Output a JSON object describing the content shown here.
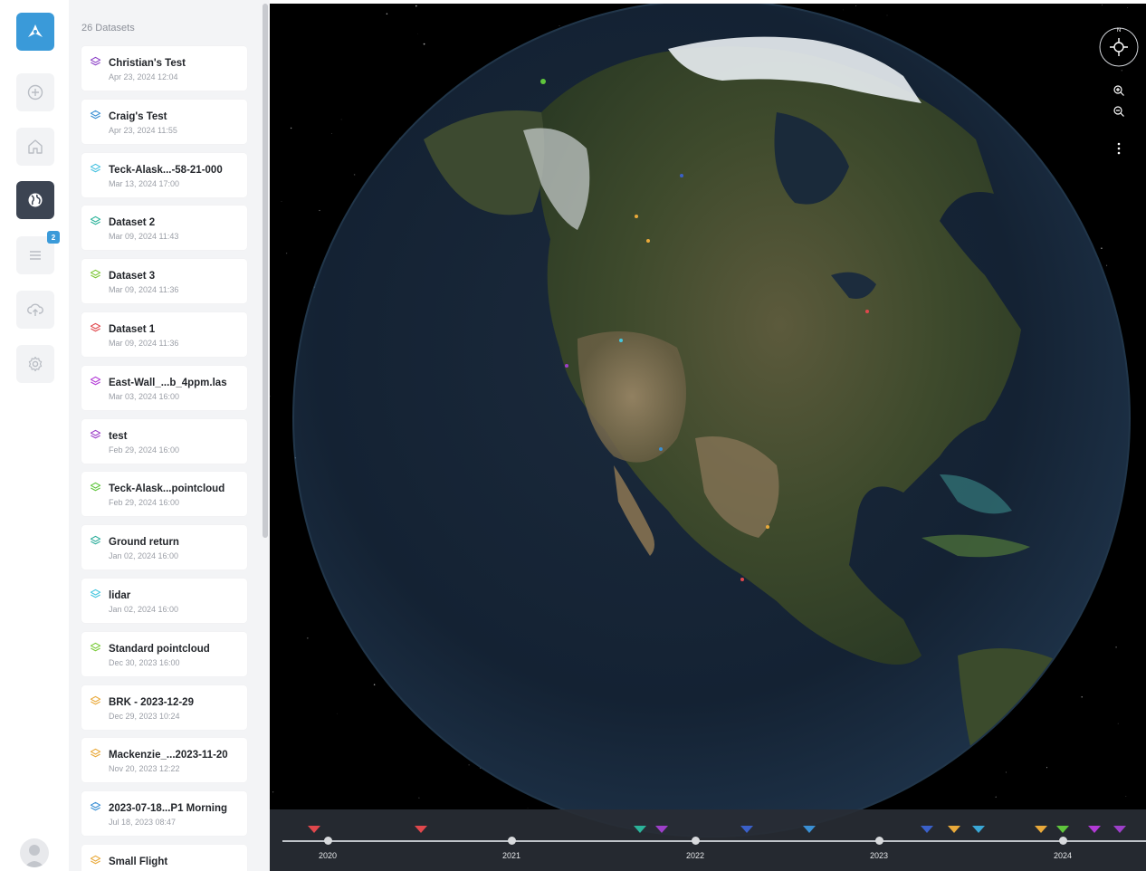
{
  "panel": {
    "title": "26 Datasets",
    "datasets": [
      {
        "name": "Christian's Test",
        "date": "Apr 23, 2024 12:04",
        "color": "#8e44c8"
      },
      {
        "name": "Craig's Test",
        "date": "Apr 23, 2024 11:55",
        "color": "#3a8fd4"
      },
      {
        "name": "Teck-Alask...-58-21-000",
        "date": "Mar 13, 2024 17:00",
        "color": "#49c2e0"
      },
      {
        "name": "Dataset 2",
        "date": "Mar 09, 2024 11:43",
        "color": "#2bb39a"
      },
      {
        "name": "Dataset 3",
        "date": "Mar 09, 2024 11:36",
        "color": "#7fc83a"
      },
      {
        "name": "Dataset 1",
        "date": "Mar 09, 2024 11:36",
        "color": "#e0474c"
      },
      {
        "name": "East-Wall_...b_4ppm.las",
        "date": "Mar 03, 2024 16:00",
        "color": "#b23ad6"
      },
      {
        "name": "test",
        "date": "Feb 29, 2024 16:00",
        "color": "#9d3fc9"
      },
      {
        "name": "Teck-Alask...pointcloud",
        "date": "Feb 29, 2024 16:00",
        "color": "#5fc53c"
      },
      {
        "name": "Ground return",
        "date": "Jan 02, 2024 16:00",
        "color": "#2fae9c"
      },
      {
        "name": "lidar",
        "date": "Jan 02, 2024 16:00",
        "color": "#45c6de"
      },
      {
        "name": "Standard pointcloud",
        "date": "Dec 30, 2023 16:00",
        "color": "#7bcb3b"
      },
      {
        "name": "BRK - 2023-12-29",
        "date": "Dec 29, 2023 10:24",
        "color": "#e9a93a"
      },
      {
        "name": "Mackenzie_...2023-11-20",
        "date": "Nov 20, 2023 12:22",
        "color": "#e9a93a"
      },
      {
        "name": "2023-07-18...P1 Morning",
        "date": "Jul 18, 2023 08:47",
        "color": "#3a8fd4"
      },
      {
        "name": "Small Flight",
        "date": "",
        "color": "#e9a93a"
      }
    ]
  },
  "rail": {
    "badge_count": "2",
    "icons": [
      "logo-icon",
      "add-icon",
      "home-icon",
      "globe-icon",
      "list-icon",
      "upload-icon",
      "settings-icon"
    ]
  },
  "map": {
    "compass_label": "N"
  },
  "timeline": {
    "years": [
      "2020",
      "2021",
      "2022",
      "2023",
      "2024"
    ],
    "marker_colors": [
      "#e0474c",
      "#e0474c",
      "#2bb39a",
      "#9d3fc9",
      "#3a60c9",
      "#3a8fd4",
      "#3a60c9",
      "#e9a93a",
      "#3aa7d6",
      "#e9a93a",
      "#5fc53c",
      "#b23ad6",
      "#9d3fc9"
    ]
  }
}
